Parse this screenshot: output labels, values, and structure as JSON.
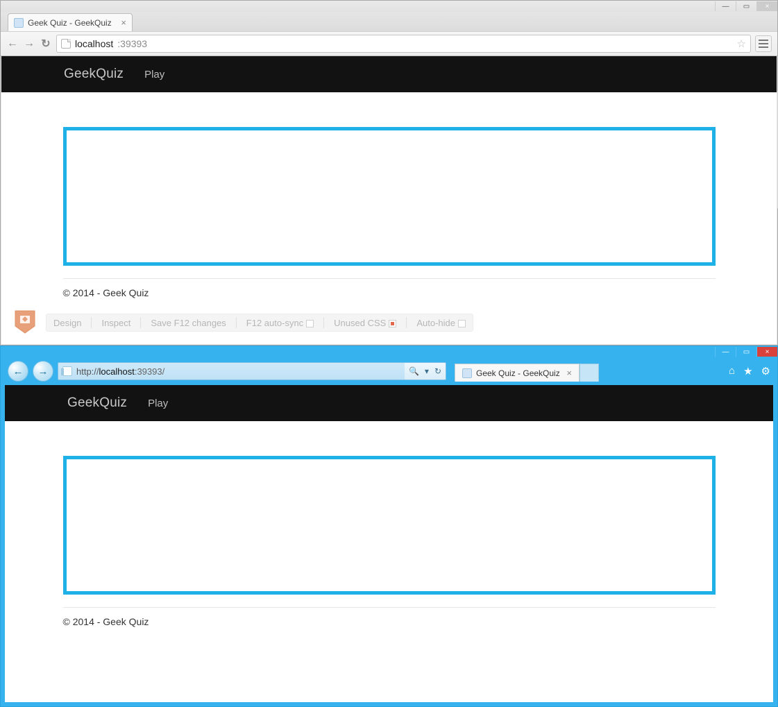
{
  "chrome": {
    "tab_title": "Geek Quiz - GeekQuiz",
    "url_host": "localhost",
    "url_port": ":39393"
  },
  "ie": {
    "url_prefix": "http://",
    "url_host": "localhost",
    "url_port": ":39393/",
    "tab_title": "Geek Quiz - GeekQuiz"
  },
  "site": {
    "brand": "GeekQuiz",
    "nav_play": "Play",
    "footer": "© 2014 - Geek Quiz"
  },
  "browserlink": {
    "design": "Design",
    "inspect": "Inspect",
    "save": "Save F12 changes",
    "autosync": "F12 auto-sync",
    "unused_css": "Unused CSS",
    "autohide": "Auto-hide"
  },
  "icons": {
    "search": "🔍",
    "dropdown": "▾",
    "refresh": "↻",
    "home": "⌂",
    "star": "★",
    "gear": "⚙",
    "back": "←",
    "forward": "→",
    "bookmark_outline": "☆",
    "close": "×",
    "minimize": "—",
    "maximize": "▭"
  }
}
